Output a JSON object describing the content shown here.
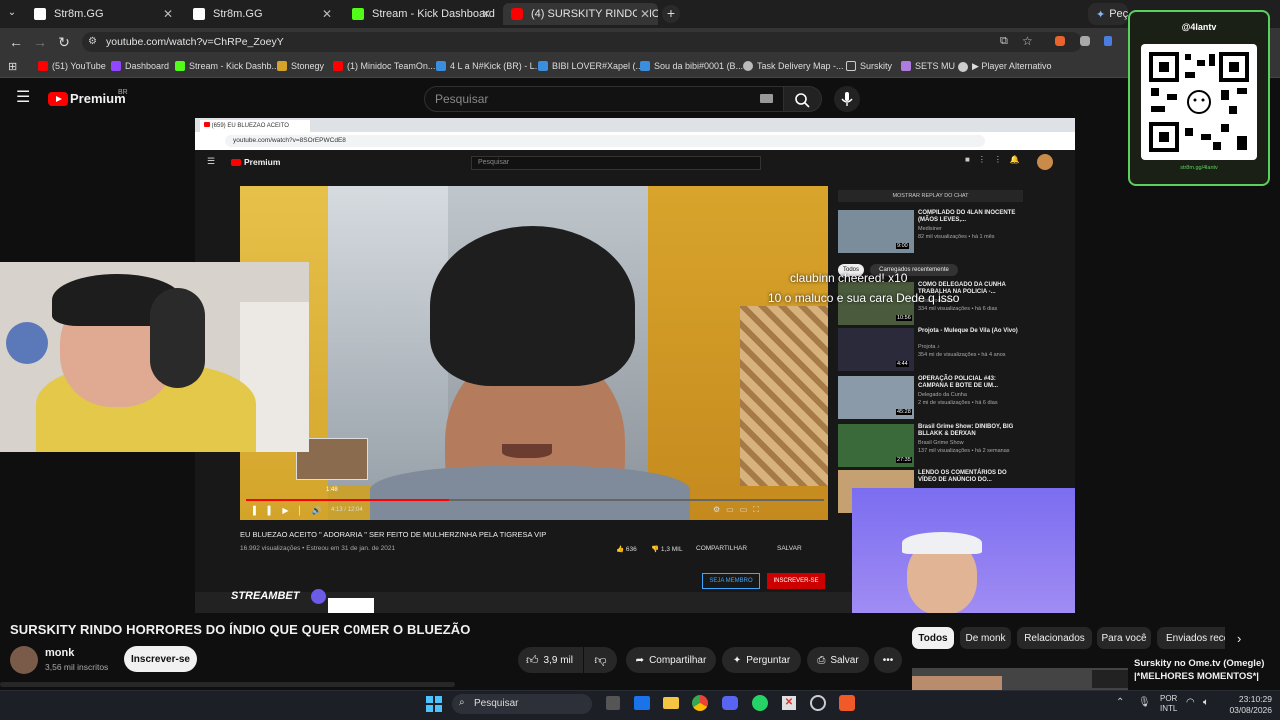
{
  "browser": {
    "tabs": [
      {
        "label": "Str8m.GG",
        "active": false
      },
      {
        "label": "Str8m.GG",
        "active": false
      },
      {
        "label": "Stream - Kick Dashboard",
        "active": false
      },
      {
        "label": "(4) SURSKITY RINDO HORRORE",
        "active": true
      }
    ],
    "extra_tab": "Peça",
    "url": "youtube.com/watch?v=ChRPe_ZoeyY",
    "bookmarks": [
      "(51) YouTube",
      "Dashboard",
      "Stream - Kick Dashb...",
      "Stonegy",
      "(1) Minidoc TeamOn...",
      "4 L a N#Kick (BR) - L...",
      "BIBI LOVER#Xapel (...",
      "Sou da bibi#0001 (B...",
      "Task Delivery Map -...",
      "Surskity",
      "SETS MU",
      "▶ Player Alternativo"
    ]
  },
  "youtube": {
    "logo": "Premium",
    "logo_badge": "BR",
    "search_placeholder": "Pesquisar",
    "video_title": "SURSKITY RINDO HORRORES DO ÍNDIO QUE QUER C0MER O BLUEZÃO",
    "channel": "monk",
    "subscribers": "3,56 mil inscritos",
    "subscribe_label": "Inscrever-se",
    "likes": "3,9 mil",
    "share_label": "Compartilhar",
    "ask_label": "Perguntar",
    "save_label": "Salvar",
    "filter_chips": [
      "Todos",
      "De monk",
      "Relacionados",
      "Para você",
      "Enviados rece"
    ],
    "rec_title": "Surskity no Ome.tv (Omegle) |*MELHORES MOMENTOS*|"
  },
  "inner": {
    "tab_label": "(659) EU BLUEZAO ACEITO",
    "url": "youtube.com/watch?v=8SOrEPWCdE8",
    "search_placeholder": "Pesquisar",
    "video_title": "EU BLUEZAO ACEITO \" ADORARIA \" SER FEITO DE MULHERZINHA PELA TIGRESA VIP",
    "video_meta": "16.992 visualizações • Estreou em 31 de jan. de 2021",
    "time": "4:13 / 12:04",
    "preview_time": "1:48",
    "likes": "636",
    "dislikes": "1,3 MIL",
    "share": "COMPARTILHAR",
    "save": "SALVAR",
    "member": "SEJA MEMBRO",
    "subscribe": "INSCREVER-SE",
    "chat_replay": "MOSTRAR REPLAY DO CHAT",
    "chips": [
      "Todos",
      "Carregados recentemente"
    ],
    "recs": [
      {
        "title": "COMPILADO DO 4LAN INOCENTE (MÃOS LEVES,...",
        "channel": "Medisiner",
        "meta": "82 mil visualizações • há 1 mês",
        "dur": "9:00"
      },
      {
        "title": "COMO DELEGADO DA CUNHA TRABALHA NA POLICIA -...",
        "channel": "Fora Podcasts",
        "meta": "334 mil visualizações • há 6 dias",
        "dur": "10:56"
      },
      {
        "title": "Projota - Muleque De Vila (Ao Vivo)",
        "channel": "Projota ♪",
        "meta": "354 mi de visualizações • há 4 anos",
        "dur": "4:44"
      },
      {
        "title": "OPERAÇÃO POLICIAL #43: CAMPANA E BOTE DE UM...",
        "channel": "Delegado da Cunha",
        "meta": "2 mi de visualizações • há 6 dias",
        "dur": "45:28"
      },
      {
        "title": "Brasil Grime Show: DINIBOY, BIG BLLAKK & DERXAN",
        "channel": "Brasil Grime Show",
        "meta": "137 mil visualizações • há 2 semanas",
        "dur": "27:35"
      },
      {
        "title": "LENDO OS COMENTÁRIOS DO VÍDEO DE ANÚNCIO DO...",
        "channel": "",
        "meta": "",
        "dur": ""
      }
    ]
  },
  "overlay": {
    "cheer": "claubinn cheered! x10",
    "message": "10 o maluco e sua cara Dede q isso",
    "qr_handle": "@4lantv",
    "qr_url": "str8m.gg/4lantv",
    "streambet": "STREAMBET"
  },
  "taskbar": {
    "search": "Pesquisar",
    "lang": "POR",
    "layout": "INTL",
    "time": "23:10:29",
    "date": "03/08/2026"
  },
  "colors": {
    "yt_red": "#ff0000",
    "kick_green": "#53fc18",
    "qr_border": "#5bd05b"
  }
}
